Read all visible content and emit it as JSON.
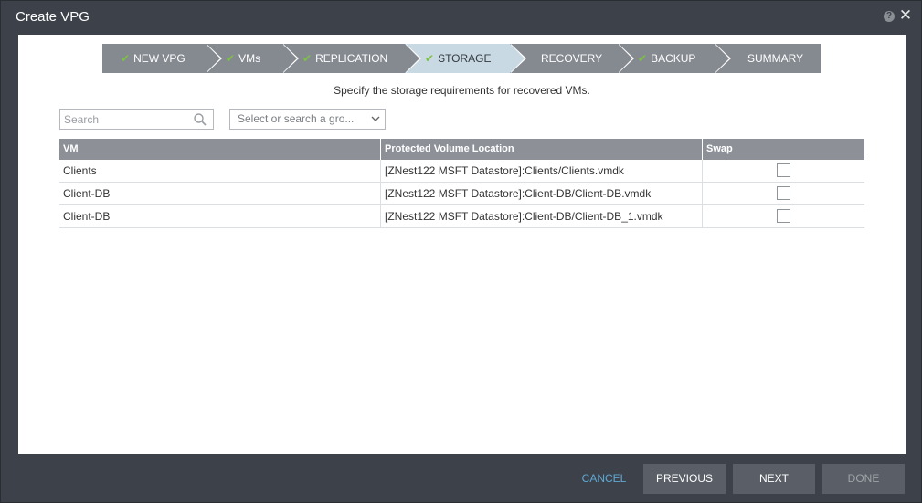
{
  "window": {
    "title": "Create VPG",
    "help_glyph": "?",
    "close_glyph": "✕"
  },
  "wizard": {
    "steps": [
      {
        "label": "NEW VPG",
        "done": true
      },
      {
        "label": "VMs",
        "done": true
      },
      {
        "label": "REPLICATION",
        "done": true
      },
      {
        "label": "STORAGE",
        "done": true,
        "active": true
      },
      {
        "label": "RECOVERY",
        "done": false
      },
      {
        "label": "BACKUP",
        "done": true
      },
      {
        "label": "SUMMARY",
        "done": false
      }
    ],
    "check_glyph": "✔"
  },
  "page": {
    "subtitle": "Specify the storage requirements for recovered VMs."
  },
  "filters": {
    "search_placeholder": "Search",
    "group_select_text": "Select or search a gro..."
  },
  "table": {
    "columns": [
      "VM",
      "Protected Volume Location",
      "Swap"
    ],
    "rows": [
      {
        "vm": "Clients",
        "location": "[ZNest122 MSFT Datastore]:Clients/Clients.vmdk",
        "swap": false
      },
      {
        "vm": "Client-DB",
        "location": "[ZNest122 MSFT Datastore]:Client-DB/Client-DB.vmdk",
        "swap": false
      },
      {
        "vm": "Client-DB",
        "location": "[ZNest122 MSFT Datastore]:Client-DB/Client-DB_1.vmdk",
        "swap": false
      }
    ]
  },
  "footer": {
    "cancel": "CANCEL",
    "previous": "PREVIOUS",
    "next": "NEXT",
    "done": "DONE"
  },
  "colors": {
    "frame": "#3d424a",
    "step_bg": "#858a91",
    "step_active_bg": "#c9d9e4",
    "check": "#7cc242",
    "cancel_link": "#5fa8d3"
  }
}
